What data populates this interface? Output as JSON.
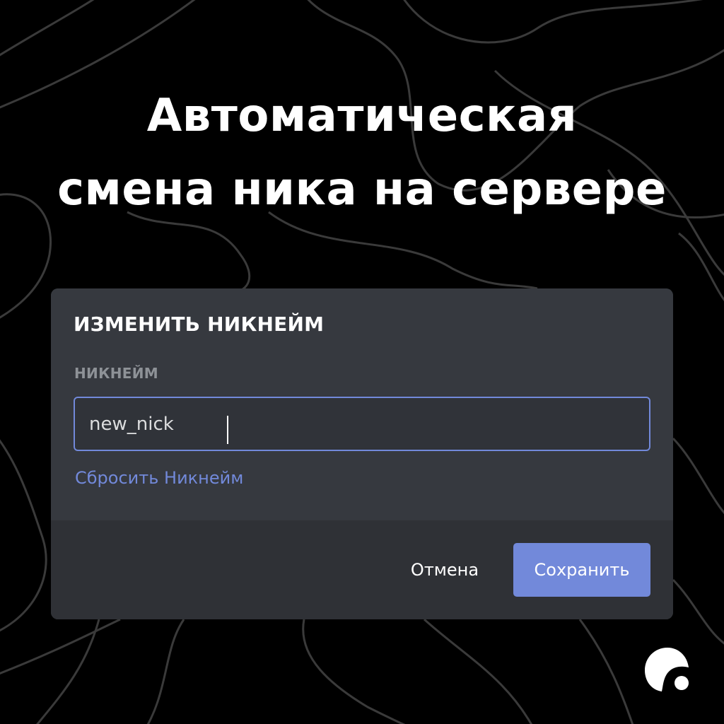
{
  "headline": {
    "line1": "Автоматическая",
    "line2": "смена ника на сервере"
  },
  "modal": {
    "title": "ИЗМЕНИТЬ НИКНЕЙМ",
    "field_label": "НИКНЕЙМ",
    "nickname_value": "new_nick",
    "reset_link": "Сбросить Никнейм",
    "cancel_label": "Отмена",
    "save_label": "Сохранить"
  },
  "icons": {
    "brand": "brand-logo-icon"
  },
  "colors": {
    "background": "#000000",
    "modal_body": "#36393f",
    "modal_footer": "#2f3136",
    "input_background": "#303339",
    "accent": "#7289da",
    "label_gray": "#8e9297",
    "text_white": "#ffffff"
  }
}
